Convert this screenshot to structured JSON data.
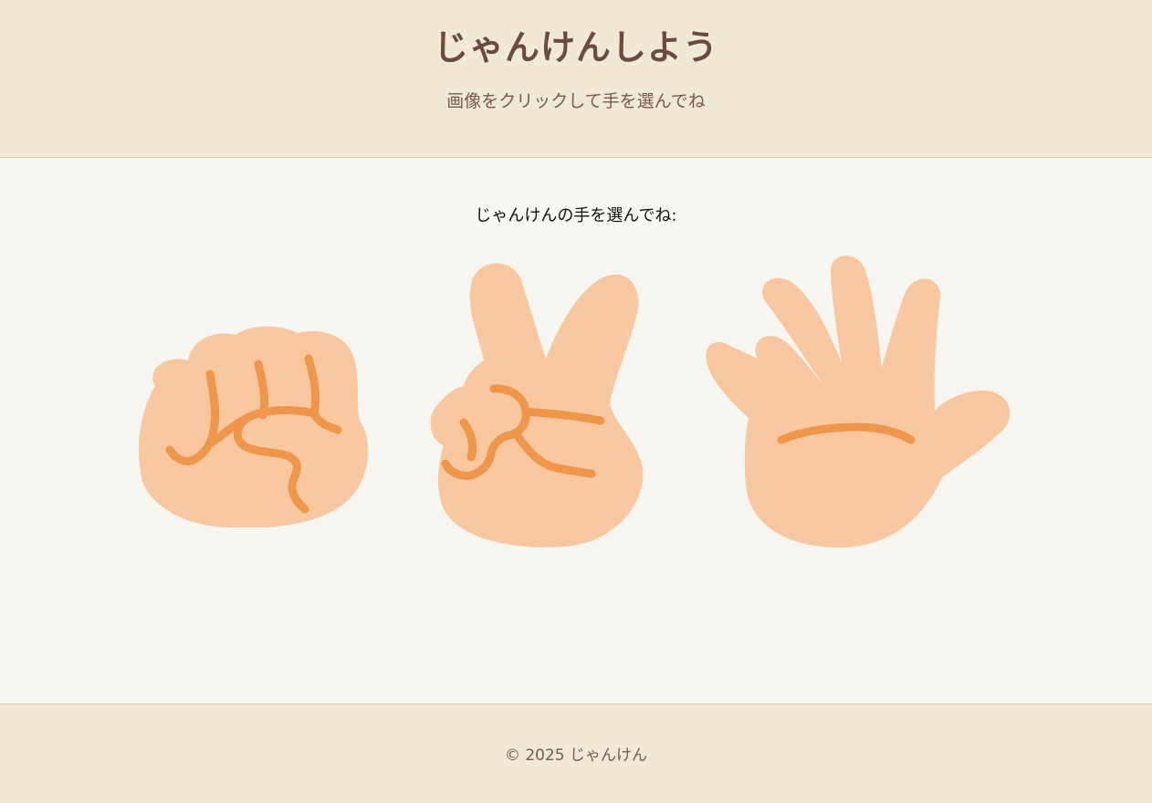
{
  "header": {
    "title": "じゃんけんしよう",
    "subtitle": "画像をクリックして手を選んでね"
  },
  "main": {
    "prompt": "じゃんけんの手を選んでね:",
    "hands": [
      {
        "name": "rock",
        "icon": "rock-hand-icon"
      },
      {
        "name": "scissors",
        "icon": "scissors-hand-icon"
      },
      {
        "name": "paper",
        "icon": "paper-hand-icon"
      }
    ]
  },
  "footer": {
    "copyright": "© 2025 じゃんけん"
  },
  "colors": {
    "header_bg": "#f1e8d6",
    "main_bg": "#f8f6f0",
    "title": "#6a4c3f",
    "skin": "#f9c8a0",
    "skin_line": "#f0964a"
  }
}
